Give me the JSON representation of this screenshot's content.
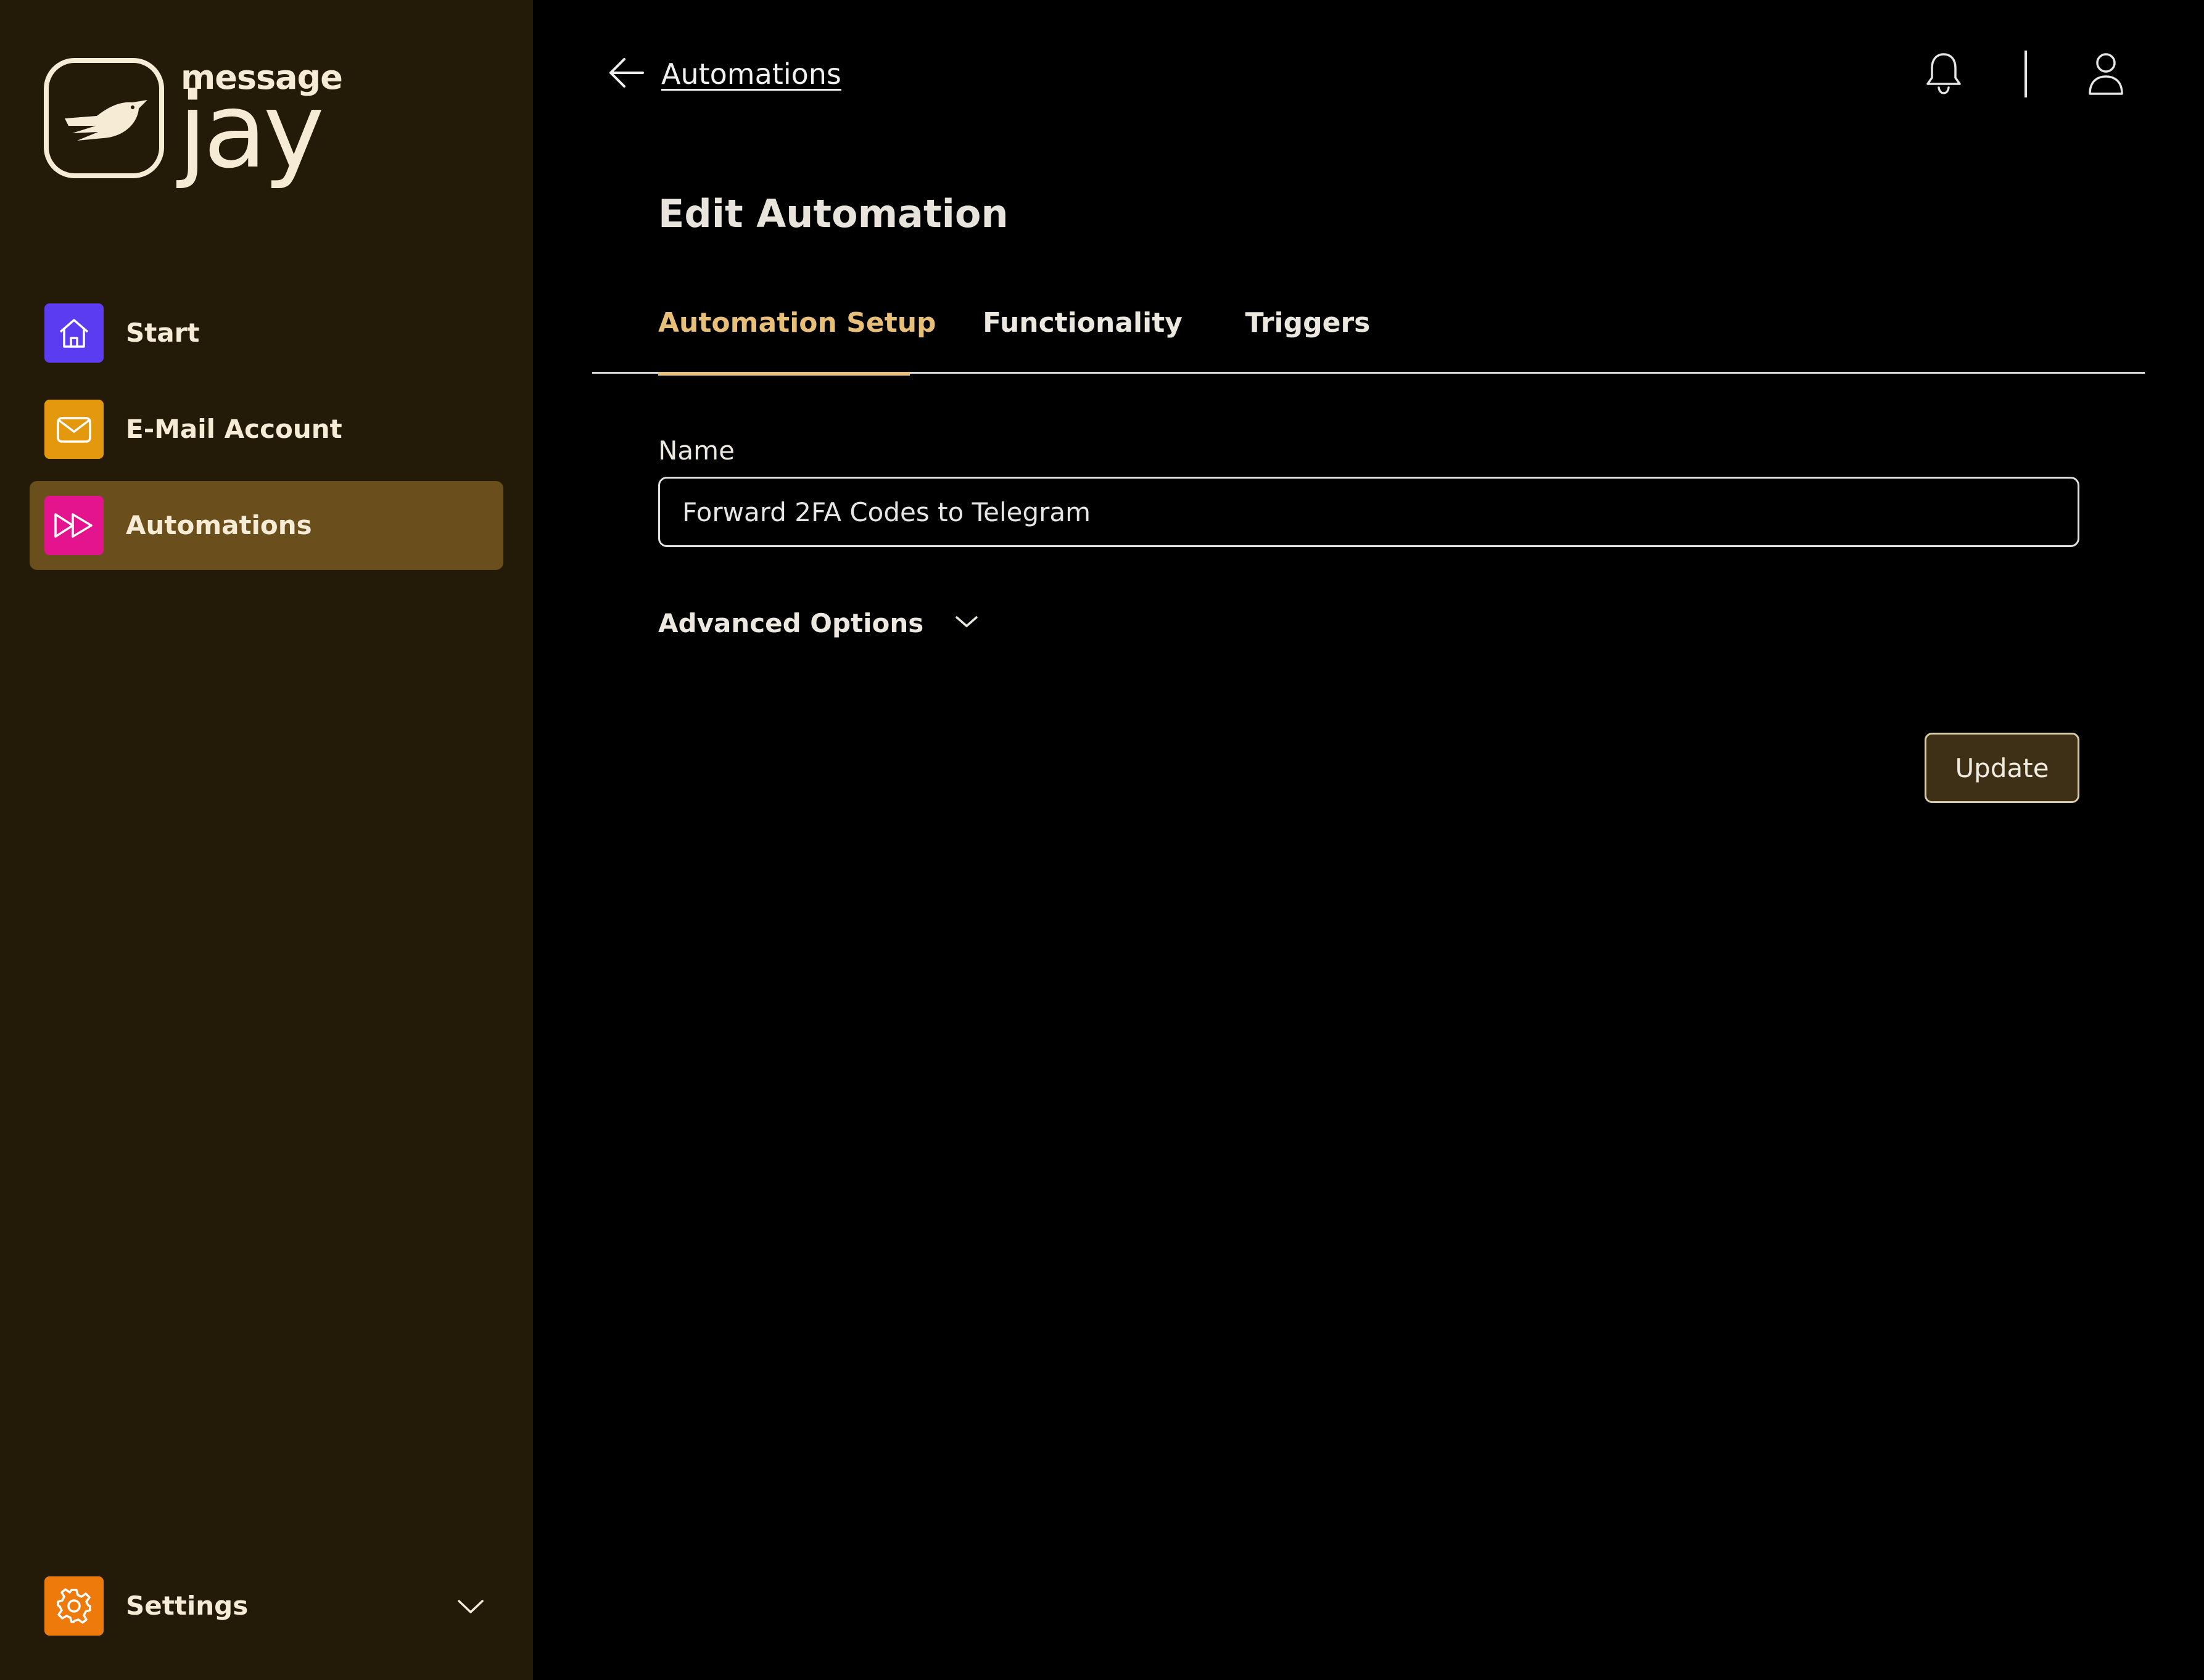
{
  "brand": {
    "small": "message",
    "big": "jay"
  },
  "sidebar": {
    "items": [
      {
        "label": "Start",
        "icon": "home-icon",
        "color": "#5b3cf0"
      },
      {
        "label": "E-Mail Account",
        "icon": "envelope-icon",
        "color": "#e4980e"
      },
      {
        "label": "Automations",
        "icon": "fast-forward-icon",
        "color": "#e4138e",
        "active": true
      }
    ],
    "settings": {
      "label": "Settings",
      "icon": "gear-icon",
      "color": "#ef7a0c"
    }
  },
  "header": {
    "back_label": "Automations"
  },
  "page": {
    "title": "Edit Automation"
  },
  "tabs": [
    {
      "label": "Automation Setup",
      "active": true
    },
    {
      "label": "Functionality"
    },
    {
      "label": "Triggers"
    }
  ],
  "form": {
    "name_label": "Name",
    "name_value": "Forward 2FA Codes to Telegram",
    "advanced_label": "Advanced Options",
    "update_label": "Update"
  },
  "colors": {
    "sidebar_bg": "#231a07",
    "active_item_bg": "#6a4f1d",
    "accent": "#e8bf78",
    "button_bg": "#3d3016"
  }
}
